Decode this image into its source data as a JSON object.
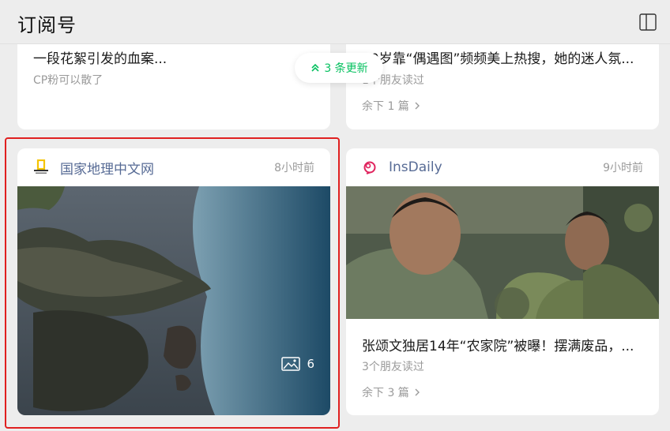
{
  "header": {
    "title": "订阅号",
    "panel_icon": "sidebar-panel-icon"
  },
  "update_pill": {
    "label": "3 条更新",
    "icon": "double-chevron-up-icon",
    "color": "#07c160"
  },
  "cards": {
    "top_left": {
      "title": "一段花絮引发的血案...",
      "meta": "CP粉可以散了"
    },
    "top_right": {
      "title": "40岁靠“偶遇图”频频美上热搜，她的迷人氛...",
      "meta": "1个朋友读过",
      "remaining": "余下 1 篇"
    },
    "bottom_left": {
      "source": "国家地理中文网",
      "time": "8小时前",
      "image_count": "6",
      "logo": "national-geographic-logo"
    },
    "bottom_right": {
      "source": "InsDaily",
      "time": "9小时前",
      "title": "张颂文独居14年“农家院”被曝！摆满废品，...",
      "meta": "3个朋友读过",
      "remaining": "余下 3 篇",
      "logo": "insdaily-logo"
    }
  },
  "colors": {
    "background": "#ededed",
    "card": "#ffffff",
    "source_link": "#576b95",
    "muted": "#9a9a9a",
    "highlight": "#e02020"
  }
}
